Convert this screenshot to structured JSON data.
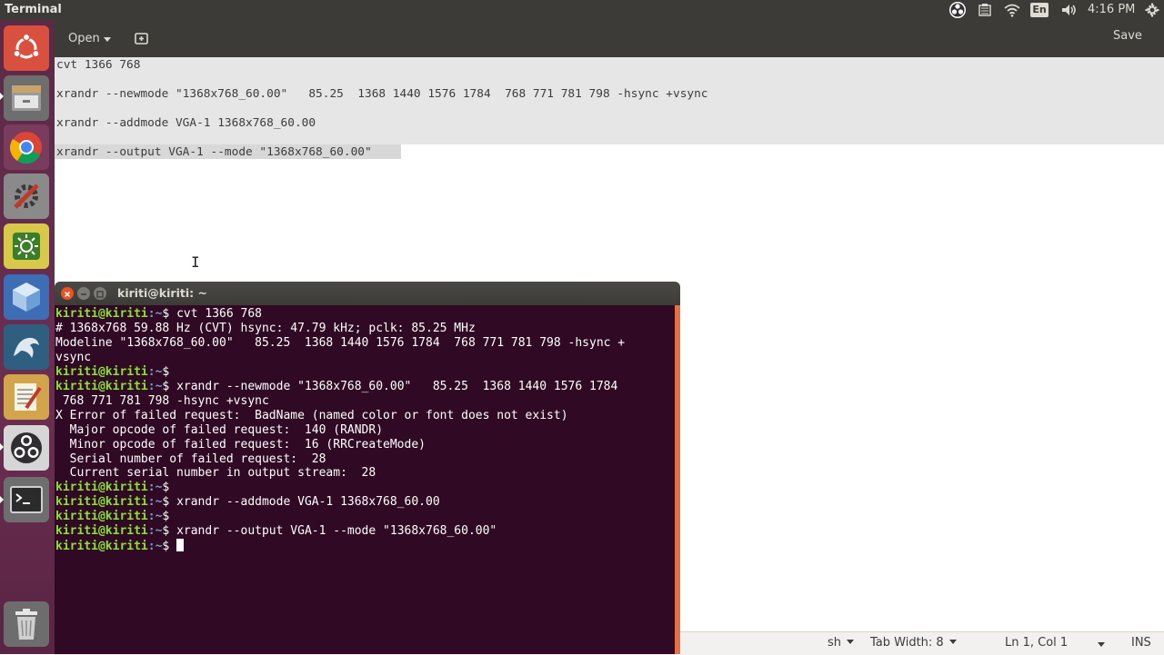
{
  "top_panel": {
    "app_title": "Terminal",
    "language": "En",
    "clock": "4:16 PM"
  },
  "launcher": {
    "items": [
      "ubuntu-dash",
      "files",
      "chrome",
      "system-settings",
      "brightness-settings",
      "virtualbox",
      "mysql-workbench",
      "text-editor",
      "obs-studio",
      "terminal",
      "trash"
    ]
  },
  "gedit": {
    "open_label": "Open",
    "save_label": "Save",
    "lines": [
      "cvt 1366 768",
      "xrandr --newmode \"1368x768_60.00\"   85.25  1368 1440 1576 1784  768 771 781 798 -hsync +vsync",
      "xrandr --addmode VGA-1 1368x768_60.00",
      "xrandr --output VGA-1 --mode \"1368x768_60.00\""
    ],
    "cursor_glyph": "I",
    "status": {
      "language": "sh",
      "tab_width": "Tab Width: 8",
      "position": "Ln 1, Col 1",
      "mode": "INS"
    }
  },
  "terminal": {
    "title": "kiriti@kiriti: ~",
    "prompt_user": "kiriti@kiriti",
    "prompt_path": ":~",
    "prompt_sign": "$ ",
    "lines": [
      {
        "type": "prompt",
        "cmd": "cvt 1366 768"
      },
      {
        "type": "out",
        "text": "# 1368x768 59.88 Hz (CVT) hsync: 47.79 kHz; pclk: 85.25 MHz"
      },
      {
        "type": "out",
        "text": "Modeline \"1368x768_60.00\"   85.25  1368 1440 1576 1784  768 771 781 798 -hsync +"
      },
      {
        "type": "out",
        "text": "vsync"
      },
      {
        "type": "prompt",
        "cmd": ""
      },
      {
        "type": "prompt",
        "cmd": "xrandr --newmode \"1368x768_60.00\"   85.25  1368 1440 1576 1784"
      },
      {
        "type": "out",
        "text": " 768 771 781 798 -hsync +vsync"
      },
      {
        "type": "out",
        "text": "X Error of failed request:  BadName (named color or font does not exist)"
      },
      {
        "type": "out",
        "text": "  Major opcode of failed request:  140 (RANDR)"
      },
      {
        "type": "out",
        "text": "  Minor opcode of failed request:  16 (RRCreateMode)"
      },
      {
        "type": "out",
        "text": "  Serial number of failed request:  28"
      },
      {
        "type": "out",
        "text": "  Current serial number in output stream:  28"
      },
      {
        "type": "prompt",
        "cmd": ""
      },
      {
        "type": "prompt",
        "cmd": "xrandr --addmode VGA-1 1368x768_60.00"
      },
      {
        "type": "prompt",
        "cmd": ""
      },
      {
        "type": "prompt",
        "cmd": "xrandr --output VGA-1 --mode \"1368x768_60.00\""
      },
      {
        "type": "prompt",
        "cmd": "",
        "cursor": true
      }
    ]
  }
}
